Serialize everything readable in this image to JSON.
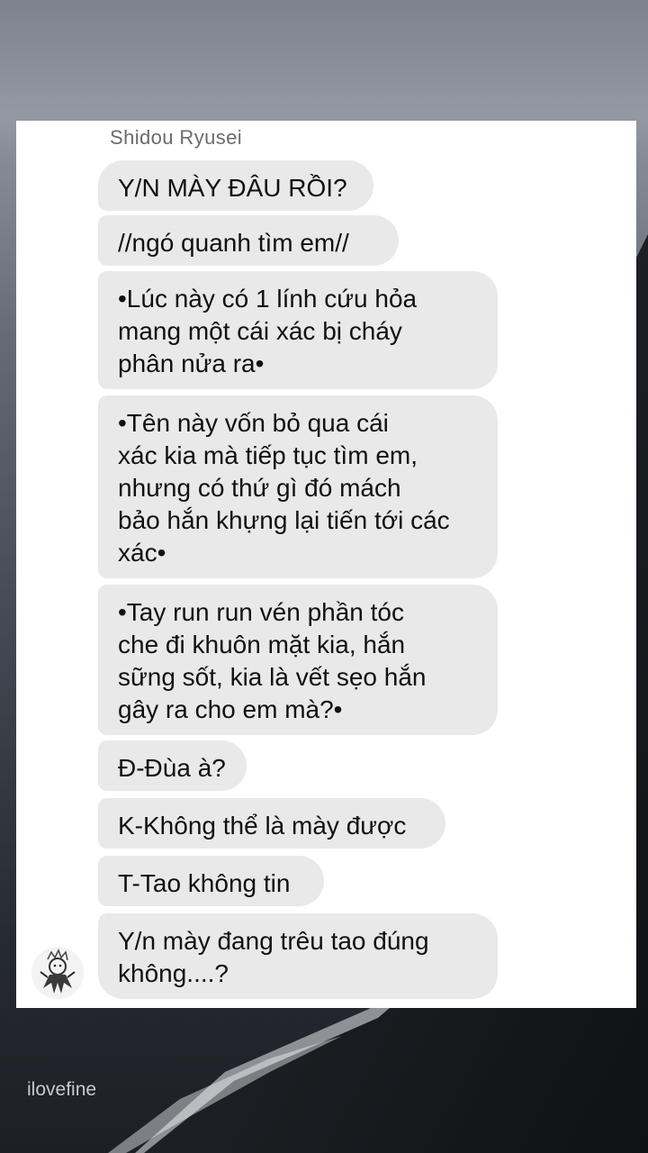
{
  "chat": {
    "sender_name": "Shidou Ryusei",
    "messages": [
      "Y/N MÀY ĐÂU RỒI?",
      "//ngó quanh tìm em//",
      "•Lúc này có 1 lính cứu hỏa\nmang một cái xác bị cháy\nphân nửa ra•",
      "•Tên này vốn bỏ qua cái\nxác kia mà tiếp tục tìm em,\nnhưng có thứ gì đó mách\nbảo hắn khựng lại tiến tới các\nxác•",
      "•Tay run run vén phần tóc\nche đi khuôn mặt kia, hắn\nsững sốt, kia là vết sẹo hắn\ngây ra cho em mà?•",
      "Đ-Đùa à?",
      "K-Không thể là mày được",
      "T-Tao không tin",
      "Y/n mày đang trêu tao đúng\nkhông....?"
    ]
  },
  "watermark": "ilovefine",
  "colors": {
    "bubble": "#e9e9ea",
    "card": "#ffffff",
    "sender_name": "#6b6b6b"
  }
}
